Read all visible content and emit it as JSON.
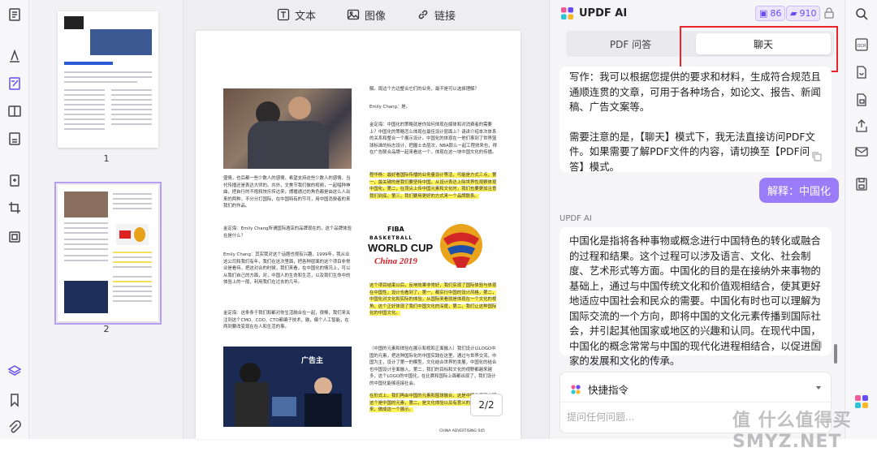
{
  "toolbar": {
    "text_label": "文本",
    "image_label": "图像",
    "link_label": "链接"
  },
  "thumbnails": {
    "page1_num": "1",
    "page2_num": "2"
  },
  "page_indicator": "2/2",
  "doc": {
    "top_text": "解。周边个方边整合它们的业务，最不是可以选择理解？",
    "speaker1": "Emily Chang：是。",
    "para_a": "金定海：中国化的策略就是你如何体现在媒体和对消费者的需要上？中国化的策略怎么体现在最佳设计层面上？请讲介绍本次体系的关系和整合一个展示设计。中国化的体现在一他们事到了世界篮球标准的标志设计，把握士去层次，NBA那么一起工程效来也，得在广告联合品牌一起来看这一个，体现在这一块中国文化的传播。",
    "para_b": "程华杨：最好看国际传播的业务量设计等活，可能是方式三点，第一，最关键的是我们要坚持中国，从设计表达上除世界性观察体现中国化，第二，在顶尖上传中国元素和文化时，我们也要更加注意我们到底，第三，我们要用更好的方式来一个品牌联系。",
    "para_c": "盛情，也后都一些少数人的感情，希望支持这些少数人的感情，当代传播还是表达大师的。共外，文美节我们做的视频，一起唱种神曲，把自行的不抱和快乐传达来，搏播通过的角色都是由这么人出来的两种，不分分打国际，在中国特有的节可，用中国消费者的来我们的作品。",
    "speaker2": "金定海：Emily Chang所谓国际酒店的品牌现在的，这个品牌体验在是什么？",
    "para_d": "Emily Chang：其实我对这个话题也很有兴趣，1999年，我从业这公司和我们有年，我们在这次里面，把各种层面的这个项目非常业是看待，把这对合的时候，我们来看，在中国化的情况上，可以从我们自己的方面，对，中国人的生命和生活，以及我们生命中的体验上的一般，利用我们在过去的几年。",
    "speaker3": "金定海：这条条于我们和都对你生活融合在一起，很棒，我们来关注到这个CMO、COO、CTO都编子技术，融，偏个人工智能，在两到要改变现在在人和生活的事。",
    "para_e": "这个项目结束以后，反响效果非常好，我们实现了国际体验与体现在中国性，设计也看到了，第一，都实行中国的设计风格，第二，中国化对文化和实际的体验，从国际来看就是体现在一个文化的视角，这个正好体现了我们中国文化的深度，第二，我们让这种国际化的中国文化。",
    "para_f": "（中国的元素和体验在展示和视和正面融入）我们设计以LOGO中国的元素，把这种国际化的中国实践在这里，通过与世界交流，中国为主，设计了第一的模型，文化结合世界的发展，中国化的结合也中国设计全面融入，第二，我们的目标和文化的视野都越来越多，这个LOGO的中国化，在比赛和国际上面都出现了，我们设计的中国化能够连接社会。",
    "para_g": "在形式上，我们再由中国的元素和篮球融合，这是中国化里面中国这个是中国的元素，第二，是文化体验以及有意义的中国化表现出来，做成这一个展示。",
    "footer": "CHINA ADVERTISING  045",
    "logo_fiba": "FIBA",
    "logo_bb": "BASKETBALL",
    "logo_wc": "WORLD CUP",
    "logo_china": "China 2019",
    "stage_sign": "广告主"
  },
  "ai": {
    "title": "UPDF AI",
    "credit1": "86",
    "credit2": "910",
    "tabs": [
      "PDF 问答",
      "聊天"
    ],
    "bubble1": "写作：我可以根据您提供的要求和材料，生成符合规范且通顺连贯的文章，可用于各种场合，如论文、报告、新闻稿、广告文案等。",
    "bubble1b": "需要注意的是，【聊天】模式下，我无法直接访问PDF文件。如果需要了解PDF文件的内容，请切换至【PDF问答】模式。",
    "user_msg": "解释：中国化",
    "ai_label": "UPDF AI",
    "bubble2": "中国化是指将各种事物或概念进行中国特色的转化或融合的过程和结果。这个过程可以涉及语言、文化、社会制度、艺术形式等方面。中国化的目的是在接纳外来事物的基础上，通过与中国传统文化和价值观相结合，使其更好地适应中国社会和民众的需要。中国化有时也可以理解为国际交流的一个方向，即将中国的文化元素传播到国际社会，并引起其他国家或地区的兴趣和认同。在现代中国，中国化的概念常常与中国的现代化进程相结合，以促进国家的发展和文化的传承。",
    "quick_label": "快捷指令",
    "input_placeholder": "提问任何问题..."
  },
  "watermark": "值 什么值得买 SMYZ.NET",
  "colors": {
    "accent": "#6a4cf5",
    "user_bubble": "#9b7cf8",
    "highlight": "#fff35a",
    "red_frame": "#e8252a"
  }
}
